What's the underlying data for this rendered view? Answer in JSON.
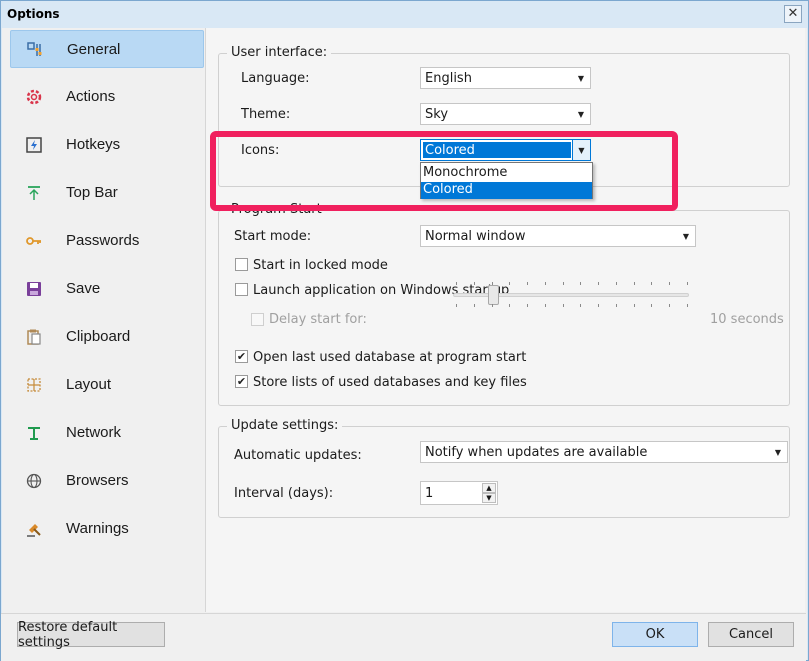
{
  "window": {
    "title": "Options",
    "close_label": "✕"
  },
  "sidebar": {
    "items": [
      {
        "label": "General",
        "icon": "settings-general-icon",
        "selected": true
      },
      {
        "label": "Actions",
        "icon": "gear-icon"
      },
      {
        "label": "Hotkeys",
        "icon": "hotkey-icon"
      },
      {
        "label": "Top Bar",
        "icon": "pin-top-icon"
      },
      {
        "label": "Passwords",
        "icon": "key-icon"
      },
      {
        "label": "Save",
        "icon": "floppy-icon"
      },
      {
        "label": "Clipboard",
        "icon": "clipboard-icon"
      },
      {
        "label": "Layout",
        "icon": "layout-icon"
      },
      {
        "label": "Network",
        "icon": "network-icon"
      },
      {
        "label": "Browsers",
        "icon": "globe-icon"
      },
      {
        "label": "Warnings",
        "icon": "gavel-icon"
      }
    ]
  },
  "ui_group": {
    "title": "User interface:",
    "language_label": "Language:",
    "language_value": "English",
    "theme_label": "Theme:",
    "theme_value": "Sky",
    "icons_label": "Icons:",
    "icons_value": "Colored",
    "icons_options": [
      "Monochrome",
      "Colored"
    ]
  },
  "startup_group": {
    "title_partial": "Program Start",
    "start_mode_label": "Start mode:",
    "start_mode_value": "Normal window",
    "locked_label": "Start in locked mode",
    "locked_checked": false,
    "launch_label": "Launch application on Windows startup",
    "launch_checked": false,
    "delay_label": "Delay start for:",
    "delay_checked": false,
    "delay_value": "10 seconds",
    "open_last_label": "Open last used database at program start",
    "open_last_checked": true,
    "store_lists_label": "Store lists of used databases and key files",
    "store_lists_checked": true
  },
  "update_group": {
    "title": "Update settings:",
    "auto_label": "Automatic updates:",
    "auto_value": "Notify when updates are available",
    "interval_label": "Interval (days):",
    "interval_value": "1"
  },
  "buttons": {
    "restore": "Restore default settings",
    "ok": "OK",
    "cancel": "Cancel"
  },
  "colors": {
    "highlight": "#f0205e",
    "selection": "#0078d7",
    "sidebar_selected": "#b9d9f4"
  }
}
